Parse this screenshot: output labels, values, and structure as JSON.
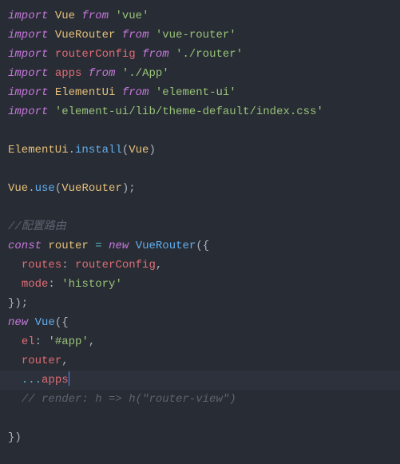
{
  "code": {
    "lines": [
      {
        "ref": "l1",
        "segments": [
          {
            "cls": "kw",
            "t": "import"
          },
          {
            "cls": "pn",
            "t": " "
          },
          {
            "cls": "cls",
            "t": "Vue"
          },
          {
            "cls": "pn",
            "t": " "
          },
          {
            "cls": "kw",
            "t": "from"
          },
          {
            "cls": "pn",
            "t": " "
          },
          {
            "cls": "str",
            "t": "'vue'"
          }
        ]
      },
      {
        "ref": "l2",
        "segments": [
          {
            "cls": "kw",
            "t": "import"
          },
          {
            "cls": "pn",
            "t": " "
          },
          {
            "cls": "cls",
            "t": "VueRouter"
          },
          {
            "cls": "pn",
            "t": " "
          },
          {
            "cls": "kw",
            "t": "from"
          },
          {
            "cls": "pn",
            "t": " "
          },
          {
            "cls": "str",
            "t": "'vue-router'"
          }
        ]
      },
      {
        "ref": "l3",
        "segments": [
          {
            "cls": "kw",
            "t": "import"
          },
          {
            "cls": "pn",
            "t": " "
          },
          {
            "cls": "var",
            "t": "routerConfig"
          },
          {
            "cls": "pn",
            "t": " "
          },
          {
            "cls": "kw",
            "t": "from"
          },
          {
            "cls": "pn",
            "t": " "
          },
          {
            "cls": "str",
            "t": "'./router'"
          }
        ]
      },
      {
        "ref": "l4",
        "segments": [
          {
            "cls": "kw",
            "t": "import"
          },
          {
            "cls": "pn",
            "t": " "
          },
          {
            "cls": "var",
            "t": "apps"
          },
          {
            "cls": "pn",
            "t": " "
          },
          {
            "cls": "kw",
            "t": "from"
          },
          {
            "cls": "pn",
            "t": " "
          },
          {
            "cls": "str",
            "t": "'./App'"
          }
        ]
      },
      {
        "ref": "l5",
        "segments": [
          {
            "cls": "kw",
            "t": "import"
          },
          {
            "cls": "pn",
            "t": " "
          },
          {
            "cls": "cls",
            "t": "ElementUi"
          },
          {
            "cls": "pn",
            "t": " "
          },
          {
            "cls": "kw",
            "t": "from"
          },
          {
            "cls": "pn",
            "t": " "
          },
          {
            "cls": "str",
            "t": "'element-ui'"
          }
        ]
      },
      {
        "ref": "l6",
        "segments": [
          {
            "cls": "kw",
            "t": "import"
          },
          {
            "cls": "pn",
            "t": " "
          },
          {
            "cls": "str",
            "t": "'element-ui/lib/theme-default/index.css'"
          }
        ]
      },
      {
        "ref": "l7",
        "segments": [
          {
            "cls": "pn",
            "t": ""
          }
        ]
      },
      {
        "ref": "l8",
        "segments": [
          {
            "cls": "cls",
            "t": "ElementUi"
          },
          {
            "cls": "pn",
            "t": "."
          },
          {
            "cls": "fn",
            "t": "install"
          },
          {
            "cls": "pn",
            "t": "("
          },
          {
            "cls": "cls",
            "t": "Vue"
          },
          {
            "cls": "pn",
            "t": ")"
          }
        ]
      },
      {
        "ref": "l9",
        "segments": [
          {
            "cls": "pn",
            "t": ""
          }
        ]
      },
      {
        "ref": "l10",
        "segments": [
          {
            "cls": "cls",
            "t": "Vue"
          },
          {
            "cls": "pn",
            "t": "."
          },
          {
            "cls": "fn",
            "t": "use"
          },
          {
            "cls": "pn",
            "t": "("
          },
          {
            "cls": "cls",
            "t": "VueRouter"
          },
          {
            "cls": "pn",
            "t": ");"
          }
        ]
      },
      {
        "ref": "l11",
        "segments": [
          {
            "cls": "pn",
            "t": ""
          }
        ]
      },
      {
        "ref": "l12",
        "segments": [
          {
            "cls": "cmt",
            "t": "//配置路由"
          }
        ]
      },
      {
        "ref": "l13",
        "segments": [
          {
            "cls": "kw",
            "t": "const"
          },
          {
            "cls": "pn",
            "t": " "
          },
          {
            "cls": "cls",
            "t": "router"
          },
          {
            "cls": "pn",
            "t": " "
          },
          {
            "cls": "op",
            "t": "="
          },
          {
            "cls": "pn",
            "t": " "
          },
          {
            "cls": "kw",
            "t": "new"
          },
          {
            "cls": "pn",
            "t": " "
          },
          {
            "cls": "fn",
            "t": "VueRouter"
          },
          {
            "cls": "pn",
            "t": "({"
          }
        ]
      },
      {
        "ref": "l14",
        "segments": [
          {
            "cls": "pn",
            "t": "  "
          },
          {
            "cls": "var",
            "t": "routes"
          },
          {
            "cls": "pn",
            "t": ": "
          },
          {
            "cls": "var",
            "t": "routerConfig"
          },
          {
            "cls": "pn",
            "t": ","
          }
        ]
      },
      {
        "ref": "l15",
        "segments": [
          {
            "cls": "pn",
            "t": "  "
          },
          {
            "cls": "var",
            "t": "mode"
          },
          {
            "cls": "pn",
            "t": ": "
          },
          {
            "cls": "str",
            "t": "'history'"
          }
        ]
      },
      {
        "ref": "l16",
        "segments": [
          {
            "cls": "pn",
            "t": "});"
          }
        ]
      },
      {
        "ref": "l17",
        "segments": [
          {
            "cls": "kw",
            "t": "new"
          },
          {
            "cls": "pn",
            "t": " "
          },
          {
            "cls": "fn",
            "t": "Vue"
          },
          {
            "cls": "pn",
            "t": "({"
          }
        ]
      },
      {
        "ref": "l18",
        "segments": [
          {
            "cls": "pn",
            "t": "  "
          },
          {
            "cls": "var",
            "t": "el"
          },
          {
            "cls": "pn",
            "t": ": "
          },
          {
            "cls": "str",
            "t": "'#app'"
          },
          {
            "cls": "pn",
            "t": ","
          }
        ]
      },
      {
        "ref": "l19",
        "segments": [
          {
            "cls": "pn",
            "t": "  "
          },
          {
            "cls": "var",
            "t": "router"
          },
          {
            "cls": "pn",
            "t": ","
          }
        ]
      },
      {
        "ref": "l20",
        "hl": true,
        "cursor": true,
        "segments": [
          {
            "cls": "pn",
            "t": "  "
          },
          {
            "cls": "op",
            "t": "..."
          },
          {
            "cls": "var",
            "t": "apps"
          }
        ]
      },
      {
        "ref": "l21",
        "segments": [
          {
            "cls": "pn",
            "t": "  "
          },
          {
            "cls": "cmt",
            "t": "// render: h => h(\"router-view\")"
          }
        ]
      },
      {
        "ref": "l22",
        "segments": [
          {
            "cls": "pn",
            "t": ""
          }
        ]
      },
      {
        "ref": "l23",
        "segments": [
          {
            "cls": "pn",
            "t": "})"
          }
        ]
      }
    ]
  }
}
